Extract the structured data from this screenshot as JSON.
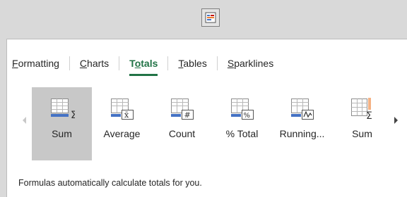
{
  "quick_analysis_button": {
    "icon": "quick-analysis-icon"
  },
  "tabs": [
    {
      "label": "Formatting",
      "accel": "F",
      "rest": "ormatting",
      "active": false
    },
    {
      "label": "Charts",
      "accel": "C",
      "rest": "harts",
      "active": false
    },
    {
      "label": "Totals",
      "lead": "T",
      "accel": "o",
      "rest": "tals",
      "active": true
    },
    {
      "label": "Tables",
      "accel": "T",
      "rest": "ables",
      "active": false
    },
    {
      "label": "Sparklines",
      "accel": "S",
      "rest": "parklines",
      "active": false
    }
  ],
  "items": [
    {
      "label": "Sum",
      "icon": "sum-rows-icon",
      "selected": true
    },
    {
      "label": "Average",
      "icon": "average-icon",
      "selected": false
    },
    {
      "label": "Count",
      "icon": "count-icon",
      "selected": false
    },
    {
      "label": "% Total",
      "icon": "percent-total-icon",
      "selected": false
    },
    {
      "label": "Running...",
      "icon": "running-total-icon",
      "selected": false
    },
    {
      "label": "Sum",
      "icon": "sum-columns-icon",
      "selected": false
    }
  ],
  "footer_text": "Formulas automatically calculate totals for you.",
  "colors": {
    "accent": "#217346",
    "selected_bg": "#c8c8c8",
    "grid_blue": "#4472c4",
    "grid_orange": "#f4b183"
  }
}
